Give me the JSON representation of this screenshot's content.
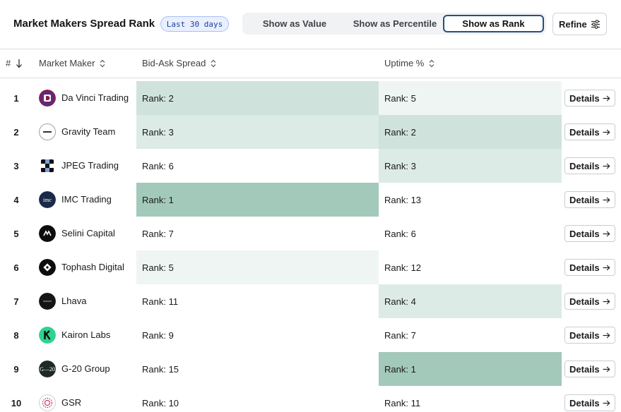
{
  "header": {
    "title": "Market Makers Spread Rank",
    "period_badge": "Last 30 days",
    "view_options": [
      "Show as Value",
      "Show as Percentile",
      "Show as Rank"
    ],
    "selected_view": "Show as Rank",
    "refine_label": "Refine"
  },
  "columns": {
    "rank": "#",
    "market_maker": "Market Maker",
    "bid_ask_spread": "Bid-Ask Spread",
    "uptime": "Uptime %"
  },
  "heat_colors": {
    "top": "#a3c9ba",
    "high": "#cfe3dc",
    "mid": "#dcebe5",
    "low": "#eff5f3",
    "none": "#ffffff"
  },
  "rows": [
    {
      "rank": "1",
      "name": "Da Vinci Trading",
      "bid_ask": "Rank: 2",
      "uptime": "Rank: 5",
      "details": "Details",
      "logo_icon": "da-vinci-logo-icon"
    },
    {
      "rank": "2",
      "name": "Gravity Team",
      "bid_ask": "Rank: 3",
      "uptime": "Rank: 2",
      "details": "Details",
      "logo_icon": "gravity-team-logo-icon"
    },
    {
      "rank": "3",
      "name": "JPEG Trading",
      "bid_ask": "Rank: 6",
      "uptime": "Rank: 3",
      "details": "Details",
      "logo_icon": "jpeg-trading-logo-icon"
    },
    {
      "rank": "4",
      "name": "IMC Trading",
      "bid_ask": "Rank: 1",
      "uptime": "Rank: 13",
      "details": "Details",
      "logo_icon": "imc-trading-logo-icon",
      "logo_text": "imc"
    },
    {
      "rank": "5",
      "name": "Selini Capital",
      "bid_ask": "Rank: 7",
      "uptime": "Rank: 6",
      "details": "Details",
      "logo_icon": "selini-capital-logo-icon"
    },
    {
      "rank": "6",
      "name": "Tophash Digital",
      "bid_ask": "Rank: 5",
      "uptime": "Rank: 12",
      "details": "Details",
      "logo_icon": "tophash-digital-logo-icon"
    },
    {
      "rank": "7",
      "name": "Lhava",
      "bid_ask": "Rank: 11",
      "uptime": "Rank: 4",
      "details": "Details",
      "logo_icon": "lhava-logo-icon"
    },
    {
      "rank": "8",
      "name": "Kairon Labs",
      "bid_ask": "Rank: 9",
      "uptime": "Rank: 7",
      "details": "Details",
      "logo_icon": "kairon-labs-logo-icon"
    },
    {
      "rank": "9",
      "name": "G-20 Group",
      "bid_ask": "Rank: 15",
      "uptime": "Rank: 1",
      "details": "Details",
      "logo_icon": "g20-group-logo-icon",
      "logo_text": "G—20"
    },
    {
      "rank": "10",
      "name": "GSR",
      "bid_ask": "Rank: 10",
      "uptime": "Rank: 11",
      "details": "Details",
      "logo_icon": "gsr-logo-icon"
    }
  ]
}
